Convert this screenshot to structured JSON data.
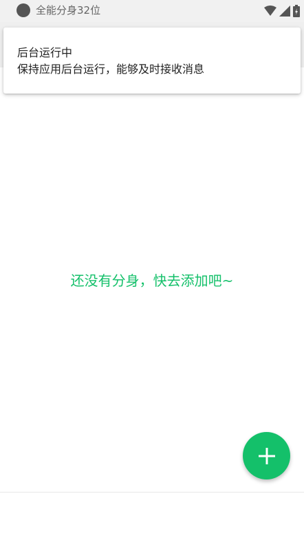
{
  "status_bar": {
    "app_label": "全能分身32位",
    "icons": [
      "wifi-icon",
      "cellular-signal-icon",
      "battery-charging-icon"
    ]
  },
  "notification": {
    "title": "后台运行中",
    "body": "保持应用后台运行，能够及时接收消息"
  },
  "main": {
    "empty_message": "还没有分身，快去添加吧~"
  },
  "fab": {
    "icon": "plus-icon"
  },
  "colors": {
    "accent": "#14c06a",
    "status_bar_bg": "#f1f1f1",
    "text_primary": "#222222"
  }
}
